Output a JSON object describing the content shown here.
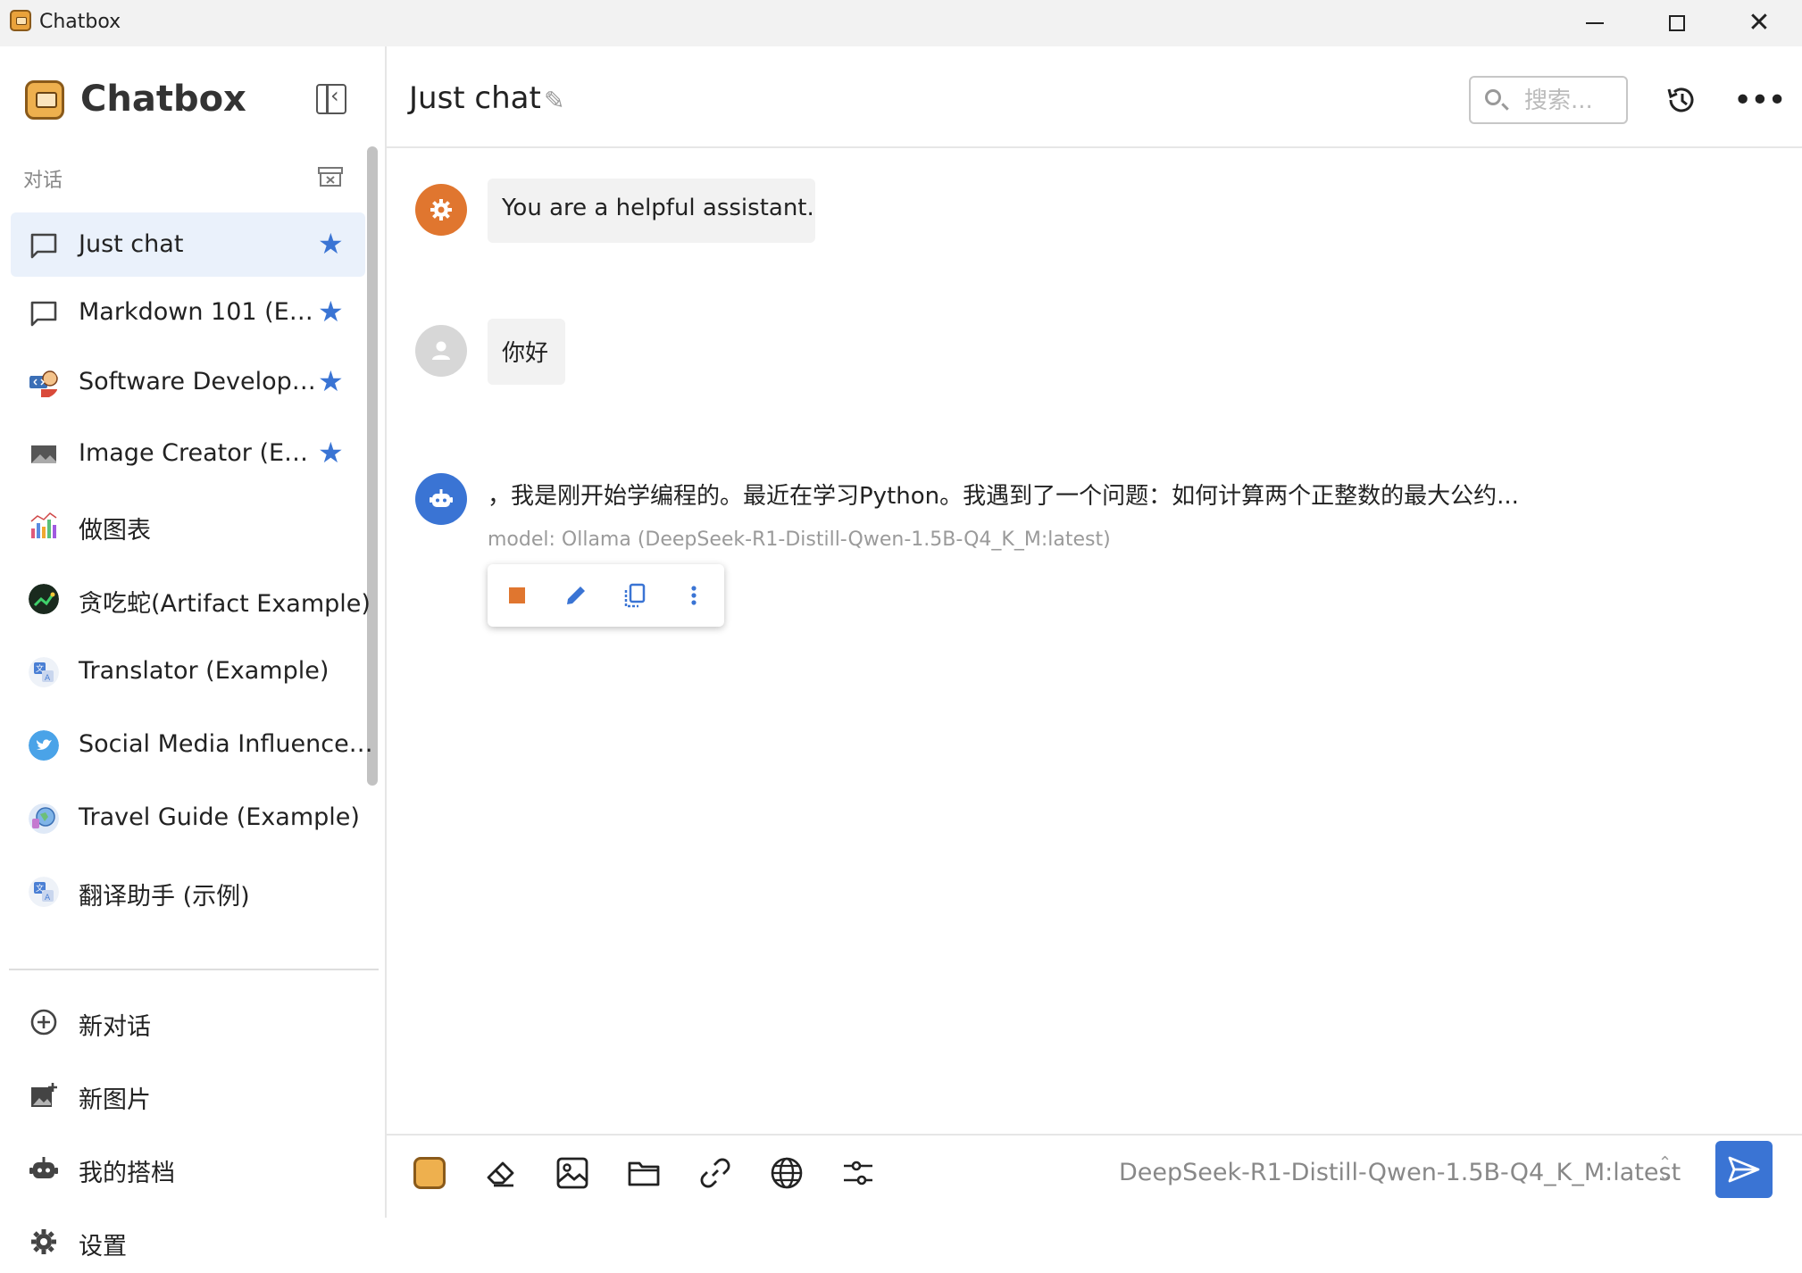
{
  "window": {
    "title": "Chatbox"
  },
  "sidebar": {
    "brand": "Chatbox",
    "section_label": "对话",
    "conversations": [
      {
        "label": "Just chat",
        "icon": "chat-bubble-icon",
        "starred": true,
        "active": true
      },
      {
        "label": "Markdown 101 (E…",
        "icon": "chat-bubble-icon",
        "starred": true
      },
      {
        "label": "Software Develop…",
        "icon": "developer-avatar",
        "starred": true
      },
      {
        "label": "Image Creator (E…",
        "icon": "image-icon",
        "starred": true
      },
      {
        "label": "做图表",
        "icon": "chart-avatar"
      },
      {
        "label": "贪吃蛇(Artifact Example)",
        "icon": "snake-game-avatar"
      },
      {
        "label": "Translator (Example)",
        "icon": "translate-avatar"
      },
      {
        "label": "Social Media Influence…",
        "icon": "twitter-avatar"
      },
      {
        "label": "Travel Guide (Example)",
        "icon": "globe-avatar"
      },
      {
        "label": "翻译助手 (示例)",
        "icon": "translate-avatar"
      }
    ],
    "actions": {
      "new_chat": "新对话",
      "new_image": "新图片",
      "my_copilots": "我的搭档",
      "settings": "设置"
    }
  },
  "header": {
    "title": "Just chat",
    "search_placeholder": "搜索..."
  },
  "messages": {
    "system": "You are a helpful assistant.",
    "user": "你好",
    "assistant": "，我是刚开始学编程的。最近在学习Python。我遇到了一个问题：如何计算两个正整数的最大公约...",
    "model_info": "model: Ollama (DeepSeek-R1-Distill-Qwen-1.5B-Q4_K_M:latest)"
  },
  "input": {
    "model": "DeepSeek-R1-Distill-Qwen-1.5B-Q4_K_M:latest"
  },
  "colors": {
    "accent": "#3a74d4",
    "system_avatar": "#e0762f",
    "user_avatar": "#d7d7d7",
    "assistant_avatar": "#3a74d4",
    "stop": "#e0762f"
  }
}
